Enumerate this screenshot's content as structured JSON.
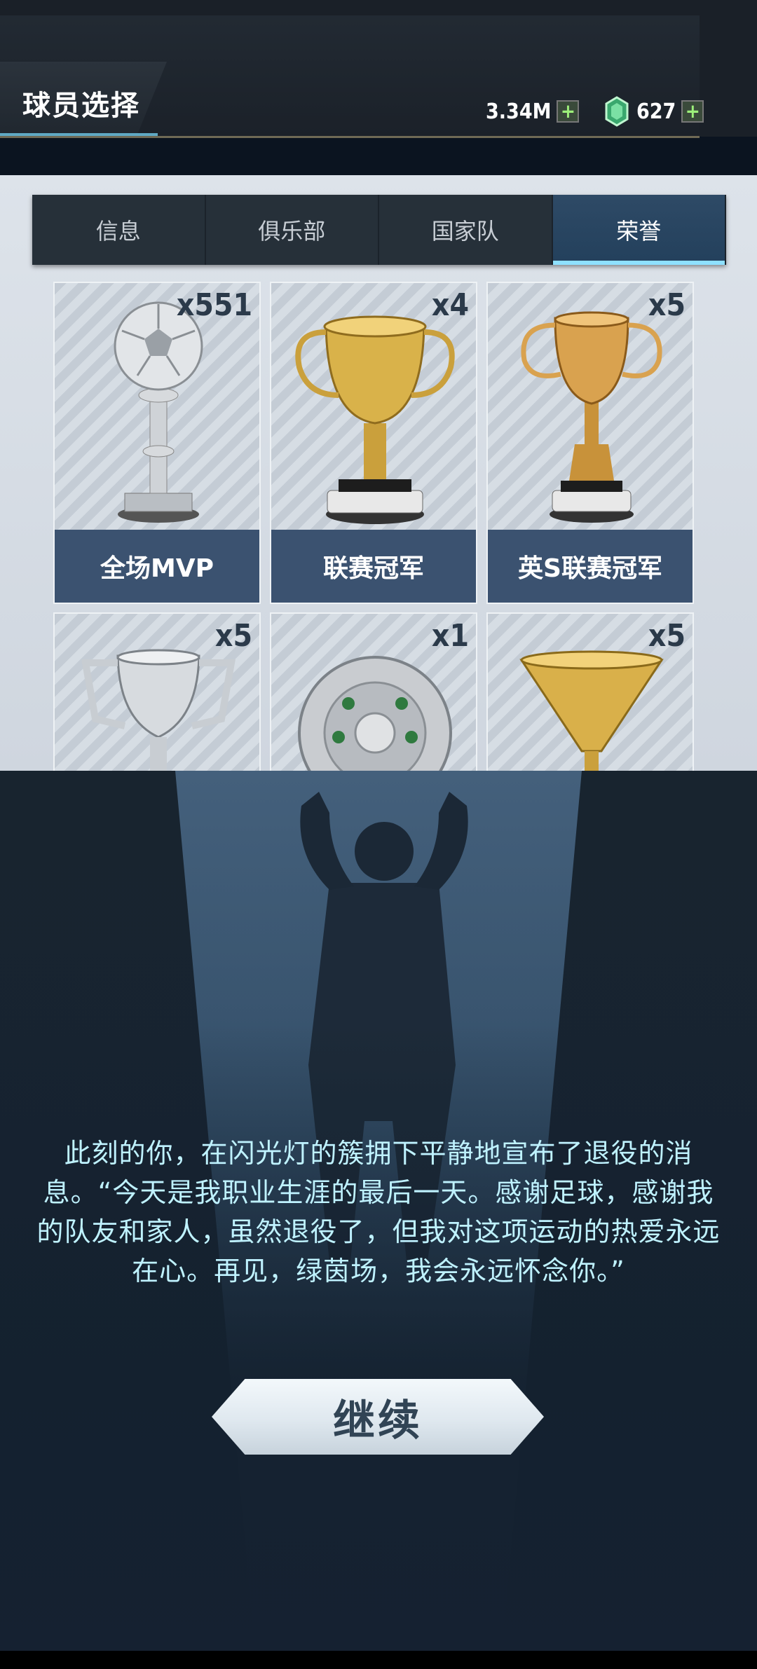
{
  "header": {
    "title": "球员选择",
    "coins": "3.34M",
    "gems": "627",
    "add_icon": "+"
  },
  "tabs": [
    {
      "label": "信息"
    },
    {
      "label": "俱乐部"
    },
    {
      "label": "国家队"
    },
    {
      "label": "荣誉",
      "active": true
    }
  ],
  "honors": [
    {
      "name": "全场MVP",
      "count": "x551",
      "icon": "silver-ball-trophy-icon"
    },
    {
      "name": "联赛冠军",
      "count": "x4",
      "icon": "gold-cup-trophy-icon"
    },
    {
      "name": "英S联赛冠军",
      "count": "x5",
      "icon": "gold-handle-trophy-icon"
    },
    {
      "name": "",
      "count": "x5",
      "icon": "silver-cup-trophy-icon"
    },
    {
      "name": "",
      "count": "x1",
      "icon": "silver-plate-trophy-icon"
    },
    {
      "name": "",
      "count": "x5",
      "icon": "gold-funnel-trophy-icon"
    }
  ],
  "retirement": {
    "message": "此刻的你，在闪光灯的簇拥下平静地宣布了退役的消息。“今天是我职业生涯的最后一天。感谢足球，感谢我的队友和家人，虽然退役了，但我对这项运动的热爱永远在心。再见，绿茵场，我会永远怀念你。”",
    "continue_label": "继续"
  },
  "colors": {
    "accent_blue": "#8ee0ff",
    "text_cyan": "#bff2ff",
    "card_label_bg": "#3b5270"
  }
}
